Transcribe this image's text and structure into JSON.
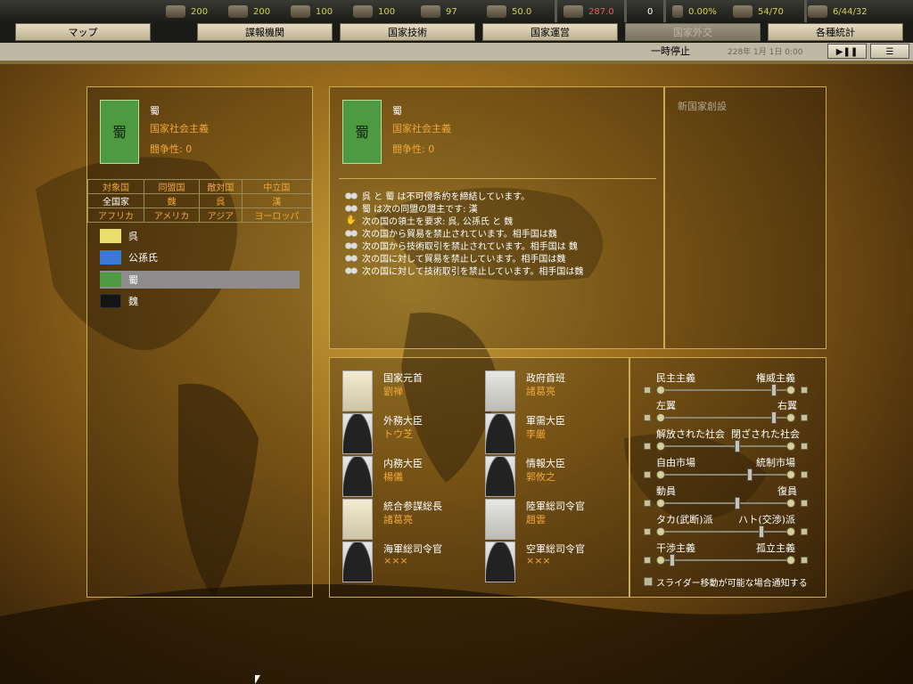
{
  "resources": [
    {
      "icon": "manpower-icon",
      "value": "200"
    },
    {
      "icon": "metal-icon",
      "value": "200"
    },
    {
      "icon": "rare-materials-icon",
      "value": "100"
    },
    {
      "icon": "oil-icon",
      "value": "100"
    },
    {
      "icon": "supplies-icon",
      "value": "97"
    },
    {
      "icon": "money-icon",
      "value": "50.0"
    },
    {
      "icon": "industry-icon",
      "value": "287.0"
    },
    {
      "icon": "transport-icon",
      "value": "0"
    },
    {
      "icon": "dissent-icon",
      "value": "0.00%"
    },
    {
      "icon": "convoy-icon",
      "value": "54/70"
    },
    {
      "icon": "diplomacy-icon",
      "value": "6/44/32"
    }
  ],
  "tabs": [
    {
      "label": "マップ"
    },
    {
      "label": "諜報機関"
    },
    {
      "label": "国家技術"
    },
    {
      "label": "国家運営"
    },
    {
      "label": "国家外交"
    },
    {
      "label": "各種統計"
    }
  ],
  "timebar": {
    "pause_label": "一時停止",
    "date": "228年 1月 1日 0:00",
    "play_pause": "▶❚❚",
    "menu": "☰"
  },
  "left_panel": {
    "country_name": "蜀",
    "flag_char": "蜀",
    "ideology": "国家社会主義",
    "belligerence": "闘争性: 0",
    "filter_row1": [
      "対象国",
      "同盟国",
      "敵対国",
      "中立国"
    ],
    "filter_row2": [
      "全国家",
      "魏",
      "呉",
      "漢"
    ],
    "filter_row3": [
      "アフリカ",
      "アメリカ",
      "アジア",
      "ヨーロッパ"
    ],
    "nations": [
      {
        "name": "呉",
        "color": "#e8e06a",
        "selected": false
      },
      {
        "name": "公孫氏",
        "color": "#3a7ad6",
        "selected": false
      },
      {
        "name": "蜀",
        "color": "#4e9a42",
        "selected": true
      },
      {
        "name": "魏",
        "color": "#151515",
        "selected": false
      }
    ]
  },
  "center_panel": {
    "country_name": "蜀",
    "flag_char": "蜀",
    "ideology": "国家社会主義",
    "belligerence": "闘争性: 0",
    "log": [
      {
        "icon": "handshake-icon",
        "text": "呉 と 蜀 は不可侵条約を締結しています。"
      },
      {
        "icon": "handshake-icon",
        "text": "蜀 は次の同盟の盟主です: 漢"
      },
      {
        "icon": "hand-icon",
        "text": "次の国の領土を要求: 呉, 公孫氏 と 魏"
      },
      {
        "icon": "handshake-icon",
        "text": "次の国から貿易を禁止されています。相手国は魏"
      },
      {
        "icon": "handshake-icon",
        "text": "次の国から技術取引を禁止されています。相手国は 魏"
      },
      {
        "icon": "handshake-icon",
        "text": "次の国に対して貿易を禁止しています。相手国は魏"
      },
      {
        "icon": "handshake-icon",
        "text": "次の国に対して技術取引を禁止しています。相手国は魏"
      }
    ]
  },
  "right_panel": {
    "title": "新国家創設"
  },
  "ministers": [
    {
      "role": "国家元首",
      "name": "劉禅",
      "portrait": "art"
    },
    {
      "role": "政府首班",
      "name": "諸葛亮",
      "portrait": "art2"
    },
    {
      "role": "外務大臣",
      "name": "トウ芝",
      "portrait": "sil"
    },
    {
      "role": "軍需大臣",
      "name": "李厳",
      "portrait": "sil"
    },
    {
      "role": "内務大臣",
      "name": "楊儀",
      "portrait": "sil"
    },
    {
      "role": "情報大臣",
      "name": "郭攸之",
      "portrait": "sil"
    },
    {
      "role": "統合参謀総長",
      "name": "諸葛亮",
      "portrait": "art"
    },
    {
      "role": "陸軍総司令官",
      "name": "趙雲",
      "portrait": "art2"
    },
    {
      "role": "海軍総司令官",
      "name": "×××",
      "portrait": "sil"
    },
    {
      "role": "空軍総司令官",
      "name": "×××",
      "portrait": "sil"
    }
  ],
  "sliders": [
    {
      "left": "民主主義",
      "right": "権威主義",
      "value": 0.9
    },
    {
      "left": "左翼",
      "right": "右翼",
      "value": 0.9
    },
    {
      "left": "解放された社会",
      "right": "閉ざされた社会",
      "value": 0.6
    },
    {
      "left": "自由市場",
      "right": "統制市場",
      "value": 0.7
    },
    {
      "left": "動員",
      "right": "復員",
      "value": 0.6
    },
    {
      "left": "タカ(武断)派",
      "right": "ハト(交渉)派",
      "value": 0.8
    },
    {
      "left": "干渉主義",
      "right": "孤立主義",
      "value": 0.05
    },
    {
      "left": "",
      "right": "",
      "value": 0.05
    }
  ],
  "notify_checkbox": "スライダー移動が可能な場合通知する"
}
